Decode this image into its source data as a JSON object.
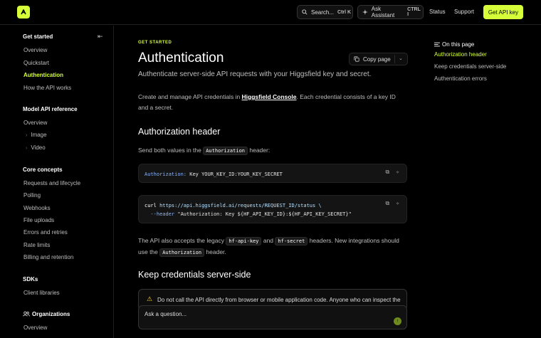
{
  "header": {
    "search_label": "Search...",
    "search_shortcut": "Ctrl K",
    "ask_label": "Ask Assistant",
    "ask_shortcut": "CTRL I",
    "status_label": "Status",
    "support_label": "Support",
    "apikey_label": "Get API key",
    "accent_color": "#d6ff3a"
  },
  "sidebar": {
    "sections": [
      {
        "title": "Get started",
        "items": [
          "Overview",
          "Quickstart",
          "Authentication",
          "How the API works"
        ]
      },
      {
        "title": "Model API reference",
        "items": [
          "Overview"
        ],
        "subitems": [
          "Image",
          "Video"
        ]
      },
      {
        "title": "Core concepts",
        "items": [
          "Requests and lifecycle",
          "Polling",
          "Webhooks",
          "File uploads",
          "Errors and retries",
          "Rate limits",
          "Billing and retention"
        ]
      },
      {
        "title": "SDKs",
        "items": [
          "Client libraries"
        ]
      },
      {
        "title": "Organizations",
        "items": [
          "Overview"
        ]
      }
    ],
    "active_item": "Authentication"
  },
  "main": {
    "eyebrow": "GET STARTED",
    "title": "Authentication",
    "copy_label": "Copy page",
    "subtitle": "Authenticate server-side API requests with your Higgsfield key and secret.",
    "intro_pre": "Create and manage API credentials in ",
    "intro_link": "Higgsfield Console",
    "intro_post": ". Each credential consists of a key ID and a secret.",
    "h2_auth": "Authorization header",
    "send_pre": "Send both values in the ",
    "send_code": "Authorization",
    "send_post": " header:",
    "code1_key": "Authorization:",
    "code1_val": " Key YOUR_KEY_ID:YOUR_KEY_SECRET",
    "code2_cmd": "curl",
    "code2_url": " https://api.higgsfield.ai/requests/REQUEST_ID/status \\",
    "code2_flag": "  --header",
    "code2_val": " \"Authorization: Key ${HF_API_KEY_ID}:${HF_API_KEY_SECRET}\"",
    "legacy_pre": "The API also accepts the legacy ",
    "legacy_code1": "hf-api-key",
    "legacy_and": " and ",
    "legacy_code2": "hf-secret",
    "legacy_mid": " headers. New integrations should use the ",
    "legacy_code3": "Authorization",
    "legacy_post": " header.",
    "h2_keep": "Keep credentials server-side",
    "alert_text": "Do not call the API directly from browser or mobile application code. Anyone who can inspect the application can extract its API secret and use your account.",
    "ask_placeholder": "Ask a question..."
  },
  "toc": {
    "title": "On this page",
    "items": [
      "Authorization header",
      "Keep credentials server-side",
      "Authentication errors"
    ]
  }
}
